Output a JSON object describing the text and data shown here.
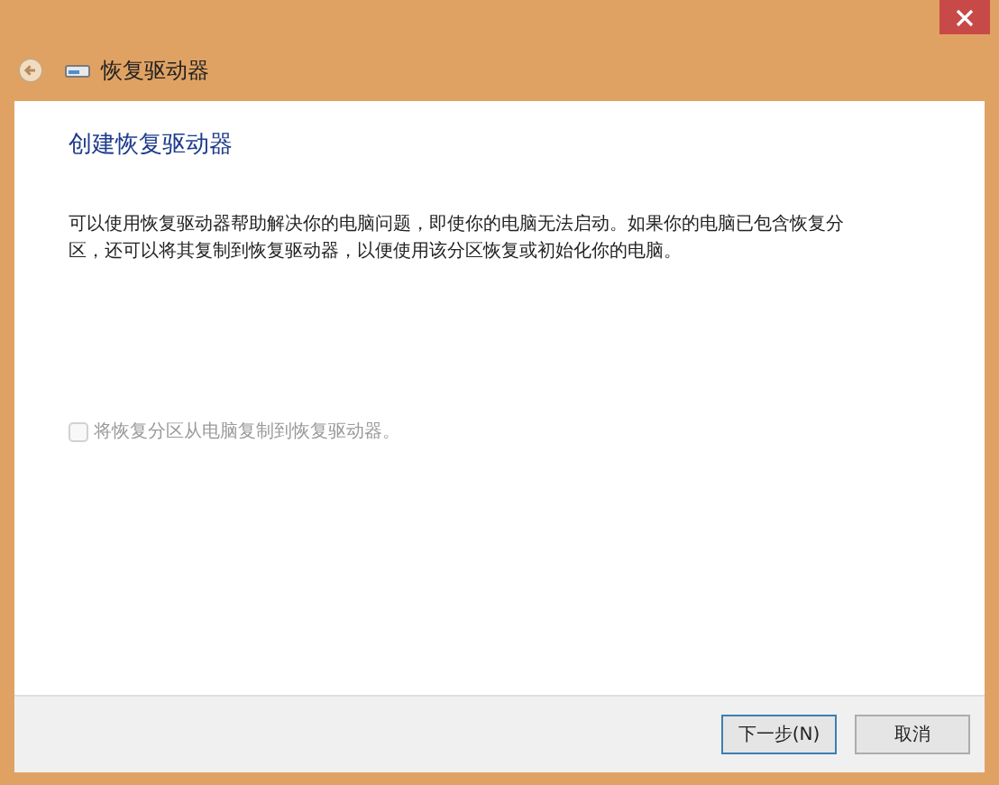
{
  "window": {
    "title": "恢复驱动器"
  },
  "heading": "创建恢复驱动器",
  "description": "可以使用恢复驱动器帮助解决你的电脑问题，即使你的电脑无法启动。如果你的电脑已包含恢复分区，还可以将其复制到恢复驱动器，以便使用该分区恢复或初始化你的电脑。",
  "option": {
    "label": "将恢复分区从电脑复制到恢复驱动器。",
    "checked": false,
    "disabled": true
  },
  "buttons": [
    {
      "label": "下一步(N)",
      "kind": "primary"
    },
    {
      "label": "取消",
      "kind": "secondary"
    }
  ]
}
